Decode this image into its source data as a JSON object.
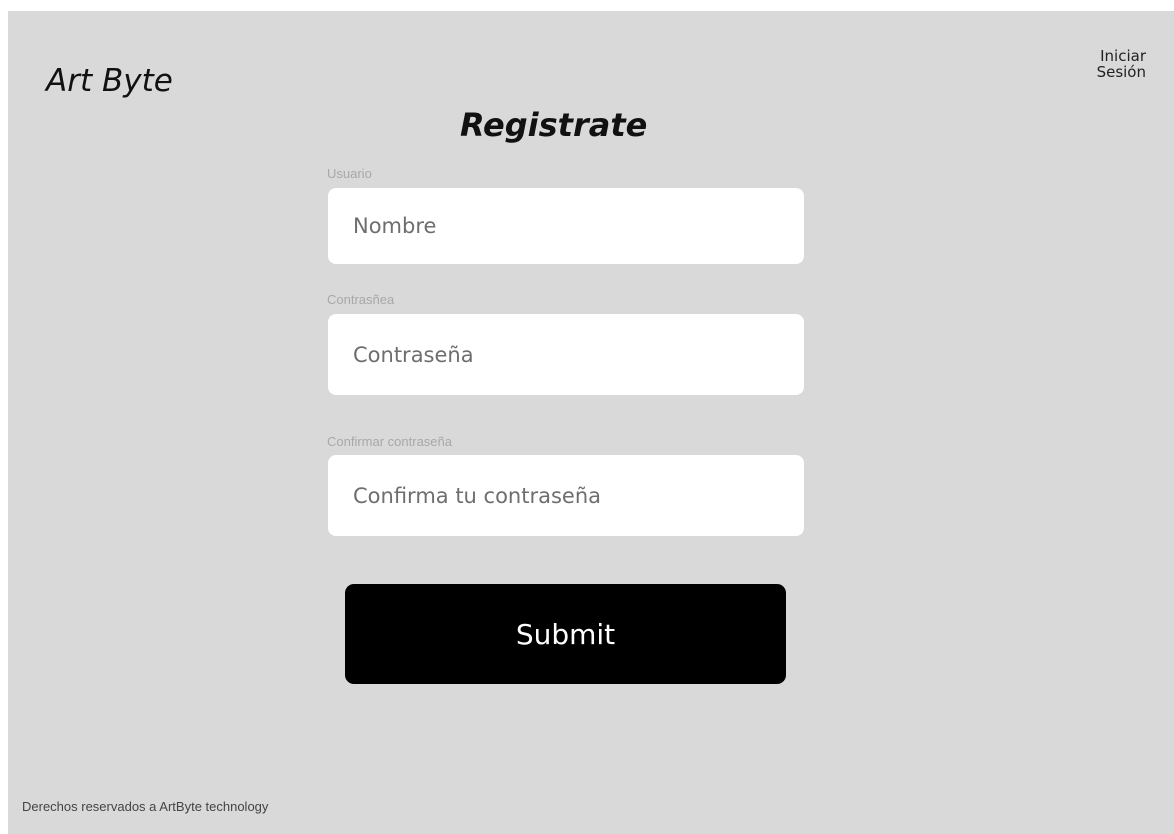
{
  "header": {
    "logo_text": "Art Byte",
    "login_label_line1": "Iniciar",
    "login_label_line2": "Sesión"
  },
  "form": {
    "title": "Registrate",
    "fields": [
      {
        "label": "Usuario",
        "placeholder": "Nombre",
        "value": ""
      },
      {
        "label": "Contrasñea",
        "placeholder": "Contraseña",
        "value": ""
      },
      {
        "label": "Confirmar contraseña",
        "placeholder": "Confirma tu contraseña",
        "value": ""
      }
    ],
    "submit_label": "Submit"
  },
  "footer": {
    "text": "Derechos reservados a ArtByte technology"
  },
  "colors": {
    "background": "#d9d9d9",
    "input_background": "#ffffff",
    "button_background": "#000000",
    "button_text": "#ffffff"
  }
}
